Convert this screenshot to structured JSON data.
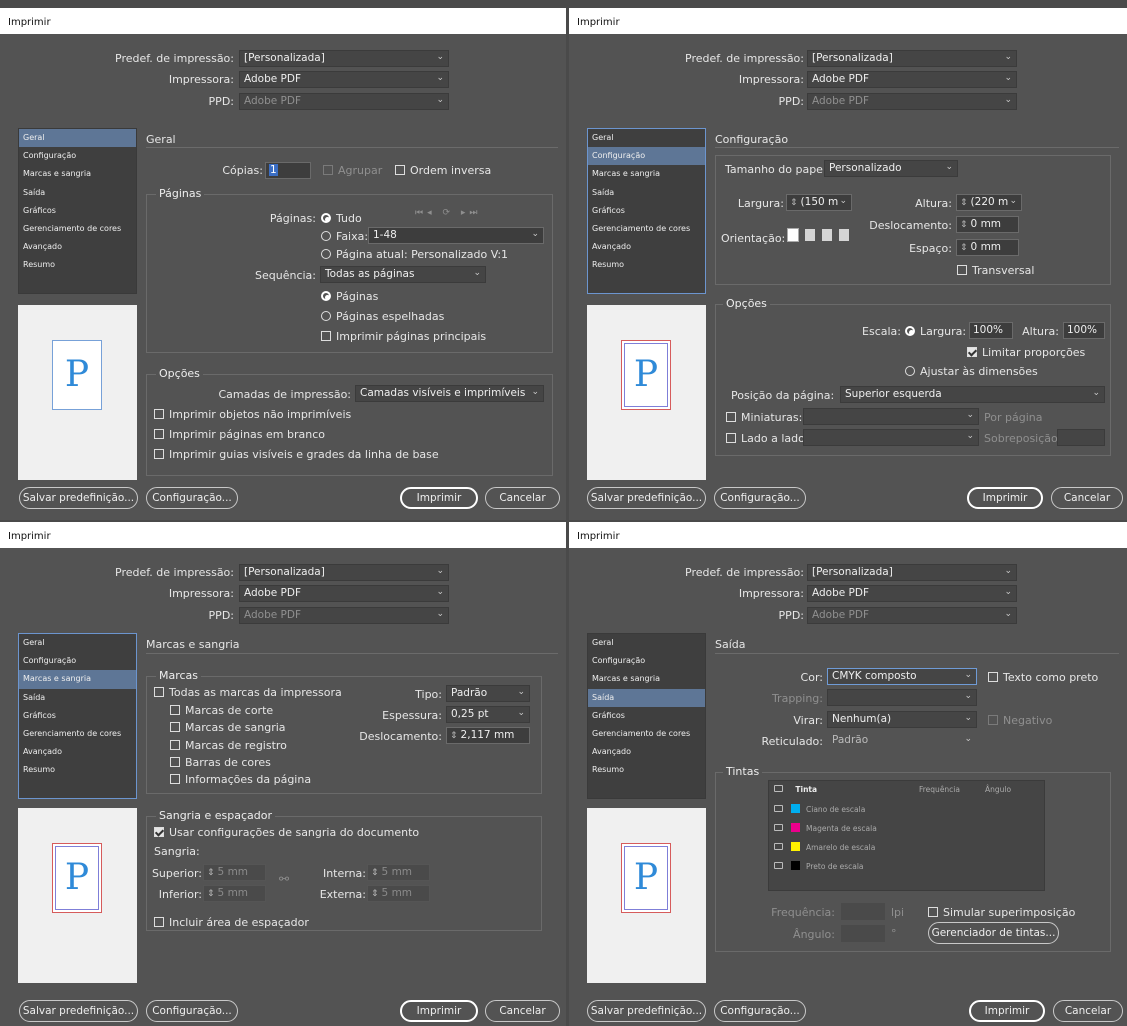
{
  "common": {
    "title": "Imprimir",
    "preset_label": "Predef. de impressão:",
    "preset_value": "[Personalizada]",
    "printer_label": "Impressora:",
    "printer_value": "Adobe PDF",
    "ppd_label": "PPD:",
    "ppd_value": "Adobe PDF",
    "sidebar": [
      "Geral",
      "Configuração",
      "Marcas e sangria",
      "Saída",
      "Gráficos",
      "Gerenciamento de cores",
      "Avançado",
      "Resumo"
    ],
    "preview_letter": "P",
    "btn_save": "Salvar predefinição...",
    "btn_setup": "Configuração...",
    "btn_print": "Imprimir",
    "btn_cancel": "Cancelar",
    "icons": {
      "chevron": "chevron-down-icon",
      "spinner": "spinner-icon",
      "printer": "printer-icon",
      "link": "link-icon"
    }
  },
  "geral": {
    "header": "Geral",
    "copies_label": "Cópias:",
    "copies_value": "1",
    "collate": "Agrupar",
    "reverse": "Ordem inversa",
    "pages_group": "Páginas",
    "pages_label": "Páginas:",
    "all": "Tudo",
    "range": "Faixa:",
    "range_value": "1-48",
    "current": "Página atual: Personalizado V:1",
    "sequence_label": "Sequência:",
    "sequence_value": "Todas as páginas",
    "pages_opt": "Páginas",
    "spreads": "Páginas espelhadas",
    "master": "Imprimir páginas principais",
    "options_group": "Opções",
    "layers_label": "Camadas de impressão:",
    "layers_value": "Camadas visíveis e imprimíveis",
    "opt1": "Imprimir objetos não imprimíveis",
    "opt2": "Imprimir páginas em branco",
    "opt3": "Imprimir guias visíveis e grades da linha de base"
  },
  "config": {
    "header": "Configuração",
    "paper_label": "Tamanho do papel:",
    "paper_value": "Personalizado",
    "width_label": "Largura:",
    "width_value": "(150 m",
    "height_label": "Altura:",
    "height_value": "(220 m",
    "offset_label": "Deslocamento:",
    "offset_value": "0 mm",
    "orient_label": "Orientação:",
    "gap_label": "Espaço:",
    "gap_value": "0 mm",
    "transverse": "Transversal",
    "options_group": "Opções",
    "scale_label": "Escala:",
    "scale_width": "Largura:",
    "scale_width_value": "100%",
    "scale_height": "Altura:",
    "scale_height_value": "100%",
    "constrain": "Limitar proporções",
    "fit": "Ajustar às dimensões",
    "position_label": "Posição da página:",
    "position_value": "Superior esquerda",
    "thumbs": "Miniaturas:",
    "per_page": "Por página",
    "tile": "Lado a lado:",
    "overlap": "Sobreposição:"
  },
  "marks": {
    "header": "Marcas e sangria",
    "marks_group": "Marcas",
    "all_marks": "Todas as marcas da impressora",
    "crop": "Marcas de corte",
    "bleed_marks": "Marcas de sangria",
    "reg": "Marcas de registro",
    "color_bars": "Barras de cores",
    "page_info": "Informações da página",
    "type_label": "Tipo:",
    "type_value": "Padrão",
    "weight_label": "Espessura:",
    "weight_value": "0,25 pt",
    "offset_label": "Deslocamento:",
    "offset_value": "2,117 mm",
    "bleed_group": "Sangria e espaçador",
    "use_doc": "Usar configurações de sangria do documento",
    "bleed_label": "Sangria:",
    "top_label": "Superior:",
    "top_value": "5 mm",
    "bottom_label": "Inferior:",
    "bottom_value": "5 mm",
    "inside_label": "Interna:",
    "inside_value": "5 mm",
    "outside_label": "Externa:",
    "outside_value": "5 mm",
    "slug": "Incluir área de espaçador"
  },
  "output": {
    "header": "Saída",
    "color_label": "Cor:",
    "color_value": "CMYK composto",
    "text_black": "Texto como preto",
    "trapping_label": "Trapping:",
    "flip_label": "Virar:",
    "flip_value": "Nenhum(a)",
    "negative": "Negativo",
    "screening_label": "Reticulado:",
    "screening_value": "Padrão",
    "inks_group": "Tintas",
    "col_ink": "Tinta",
    "col_freq": "Frequência",
    "col_angle": "Ângulo",
    "inks": [
      {
        "name": "Ciano de escala",
        "color": "#00aeef"
      },
      {
        "name": "Magenta de escala",
        "color": "#ec008c"
      },
      {
        "name": "Amarelo de escala",
        "color": "#fff200"
      },
      {
        "name": "Preto de escala",
        "color": "#000000"
      }
    ],
    "freq_label": "Frequência:",
    "lpi": "lpi",
    "angle_label": "Ângulo:",
    "degree": "°",
    "simulate": "Simular superimposição",
    "ink_manager": "Gerenciador de tintas..."
  }
}
